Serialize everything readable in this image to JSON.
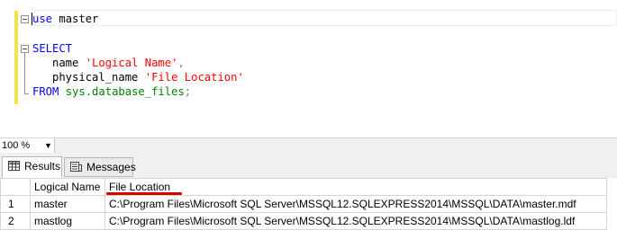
{
  "editor": {
    "lines": [
      {
        "parts": [
          {
            "t": "use",
            "c": "kw"
          },
          {
            "t": " master",
            "c": "plain"
          }
        ]
      },
      {
        "parts": [
          {
            "t": "SELECT",
            "c": "kw"
          }
        ]
      },
      {
        "parts": [
          {
            "t": "   name ",
            "c": "plain"
          },
          {
            "t": "'Logical Name'",
            "c": "str"
          },
          {
            "t": ",",
            "c": "gray"
          }
        ]
      },
      {
        "parts": [
          {
            "t": "   physical_name ",
            "c": "plain"
          },
          {
            "t": "'File Location'",
            "c": "str"
          }
        ]
      },
      {
        "parts": [
          {
            "t": "FROM",
            "c": "kw"
          },
          {
            "t": " ",
            "c": "plain"
          },
          {
            "t": "sys.database_files",
            "c": "sysobj"
          },
          {
            "t": ";",
            "c": "gray"
          }
        ]
      }
    ]
  },
  "zoom": {
    "value": "100 %"
  },
  "tabs": [
    {
      "label": "Results",
      "active": true,
      "icon": "grid-icon"
    },
    {
      "label": "Messages",
      "active": false,
      "icon": "messages-icon"
    }
  ],
  "grid": {
    "columns": [
      "",
      "Logical Name",
      "File Location"
    ],
    "rows": [
      {
        "num": "1",
        "cells": [
          "master",
          "C:\\Program Files\\Microsoft SQL Server\\MSSQL12.SQLEXPRESS2014\\MSSQL\\DATA\\master.mdf"
        ]
      },
      {
        "num": "2",
        "cells": [
          "mastlog",
          "C:\\Program Files\\Microsoft SQL Server\\MSSQL12.SQLEXPRESS2014\\MSSQL\\DATA\\mastlog.ldf"
        ]
      }
    ]
  },
  "colors": {
    "keyword": "#0000ff",
    "string": "#ff0000",
    "sysobject": "#008000",
    "annotation": "#d40000"
  }
}
